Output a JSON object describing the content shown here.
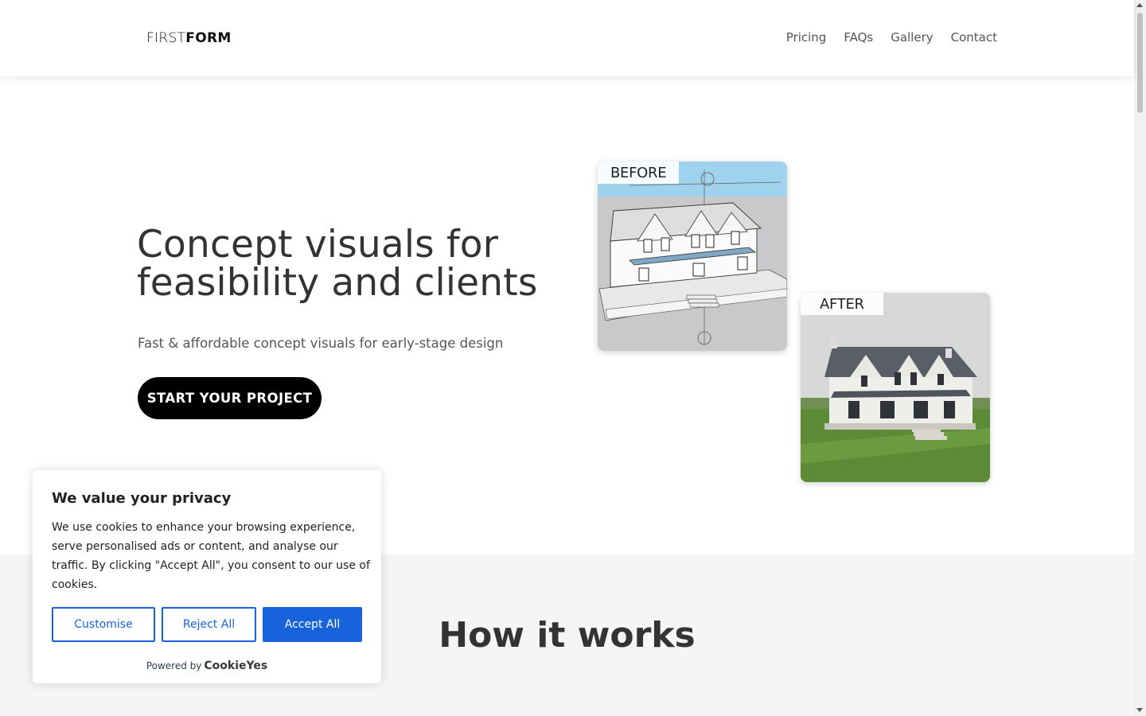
{
  "header": {
    "logo_light": "FIRST",
    "logo_bold": "FORM",
    "nav": [
      "Pricing",
      "FAQs",
      "Gallery",
      "Contact"
    ]
  },
  "hero": {
    "title_line1": "Concept visuals for",
    "title_line2": "feasibility and clients",
    "subtitle": "Fast & affordable concept visuals for early-stage design",
    "cta_label": "START YOUR PROJECT"
  },
  "cards": {
    "before_label": "BEFORE",
    "after_label": "AFTER"
  },
  "section": {
    "how_title": "How it works"
  },
  "cookie": {
    "title": "We value your privacy",
    "text": "We use cookies to enhance your browsing experience, serve personalised ads or content, and analyse our traffic. By clicking \"Accept All\", you consent to our use of cookies.",
    "customise_label": "Customise",
    "reject_label": "Reject All",
    "accept_label": "Accept All",
    "powered_by": "Powered by",
    "brand": "CookieYes"
  },
  "colors": {
    "accent": "#1863dc",
    "cta_bg": "#000000",
    "section_bg": "#f5f5f5"
  }
}
